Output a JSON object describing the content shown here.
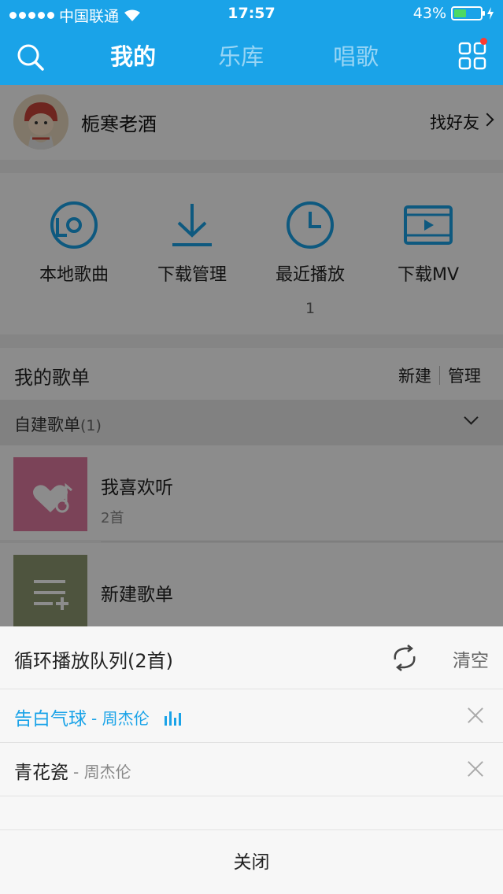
{
  "status_bar": {
    "carrier": "中国联通",
    "time": "17:57",
    "battery": "43%",
    "battery_level": 0.43
  },
  "nav": {
    "tabs": [
      {
        "label": "我的",
        "active": true
      },
      {
        "label": "乐库",
        "active": false
      },
      {
        "label": "唱歌",
        "active": false
      }
    ],
    "icons": [
      "search-icon",
      "grid-menu-icon"
    ]
  },
  "profile": {
    "username": "栀寒老酒",
    "find_friends": "找好友"
  },
  "shortcuts": [
    {
      "label": "本地歌曲",
      "icon": "local-music-icon"
    },
    {
      "label": "下载管理",
      "icon": "download-icon"
    },
    {
      "label": "最近播放",
      "icon": "clock-icon",
      "count": "1"
    },
    {
      "label": "下载MV",
      "icon": "video-icon"
    }
  ],
  "playlists": {
    "title": "我的歌单",
    "new_label": "新建",
    "manage_label": "管理",
    "group_label": "自建歌单",
    "group_count": "(1)",
    "items": [
      {
        "name": "我喜欢听",
        "subtitle": "2首"
      },
      {
        "name": "新建歌单"
      }
    ]
  },
  "queue_sheet": {
    "title": "循环播放队列(2首)",
    "clear_label": "清空",
    "close_label": "关闭",
    "songs": [
      {
        "title": "告白气球",
        "artist": "- 周杰伦",
        "playing": true
      },
      {
        "title": "青花瓷",
        "artist": "- 周杰伦",
        "playing": false
      }
    ]
  },
  "colors": {
    "brand_blue": "#1aa3e8",
    "fav_cover": "#e07aa0",
    "new_cover": "#8f9a72"
  }
}
